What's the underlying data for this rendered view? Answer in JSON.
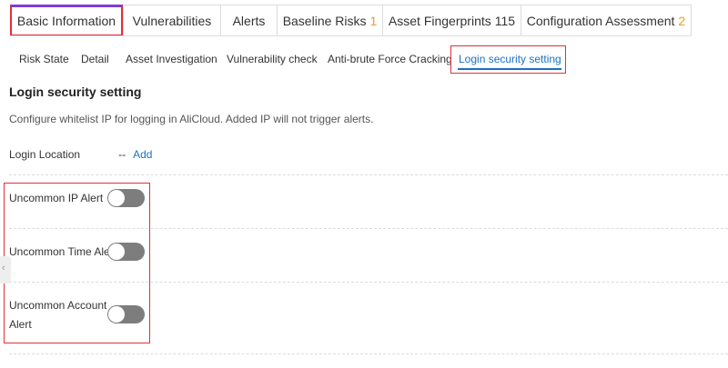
{
  "top_tabs": [
    {
      "label": "Basic Information",
      "count": ""
    },
    {
      "label": "Vulnerabilities",
      "count": ""
    },
    {
      "label": "Alerts",
      "count": ""
    },
    {
      "label": "Baseline Risks",
      "count": "1"
    },
    {
      "label": "Asset Fingerprints",
      "count": "115"
    },
    {
      "label": "Configuration Assessment",
      "count": "2"
    }
  ],
  "active_top_tab": "Basic Information",
  "sub_tabs": [
    {
      "label": "Risk State"
    },
    {
      "label": "Detail"
    },
    {
      "label": "Asset Investigation"
    },
    {
      "label": "Vulnerability check"
    },
    {
      "label": "Anti-brute Force Cracking"
    },
    {
      "label": "Login security setting"
    }
  ],
  "active_sub_tab": "Login security setting",
  "section": {
    "title": "Login security setting",
    "description": "Configure whitelist IP for logging in AliCloud. Added IP will not trigger alerts."
  },
  "login_location": {
    "label": "Login Location",
    "value": "--",
    "add_label": "Add"
  },
  "alerts": [
    {
      "label": "Uncommon IP Alert",
      "enabled": false
    },
    {
      "label": "Uncommon Time Alert",
      "enabled": false
    },
    {
      "label_line1": "Uncommon Account",
      "label_line2": "Alert",
      "enabled": false
    }
  ],
  "side_handle_glyph": "‹",
  "colors": {
    "accent_blue": "#1a72c4",
    "highlight_red": "#e0303a",
    "count_orange": "#f59a23",
    "toggle_off": "#7d7d7d"
  }
}
